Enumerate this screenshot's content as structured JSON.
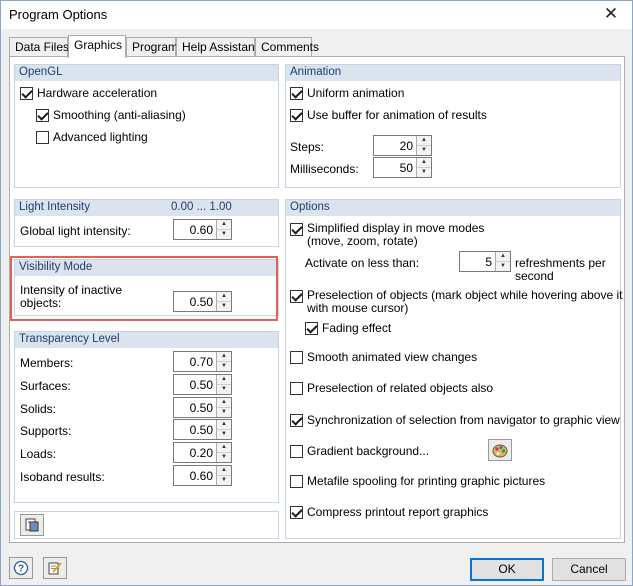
{
  "window": {
    "title": "Program Options"
  },
  "tabs": [
    "Data Files",
    "Graphics",
    "Program",
    "Help Assistant",
    "Comments"
  ],
  "opengl": {
    "header": "OpenGL",
    "hardware_acceleration": "Hardware acceleration",
    "smoothing": "Smoothing (anti-aliasing)",
    "advanced_lighting": "Advanced lighting"
  },
  "animation": {
    "header": "Animation",
    "uniform": "Uniform animation",
    "buffer": "Use buffer for animation of results",
    "steps_label": "Steps:",
    "steps_value": "20",
    "ms_label": "Milliseconds:",
    "ms_value": "50"
  },
  "light": {
    "header": "Light Intensity",
    "range": "0.00 ... 1.00",
    "global_label": "Global light intensity:",
    "global_value": "0.60"
  },
  "visibility": {
    "header": "Visibility Mode",
    "inactive_label_1": "Intensity of inactive",
    "inactive_label_2": "objects:",
    "inactive_value": "0.50"
  },
  "transparency": {
    "header": "Transparency Level",
    "rows": [
      {
        "label": "Members:",
        "value": "0.70"
      },
      {
        "label": "Surfaces:",
        "value": "0.50"
      },
      {
        "label": "Solids:",
        "value": "0.50"
      },
      {
        "label": "Supports:",
        "value": "0.50"
      },
      {
        "label": "Loads:",
        "value": "0.20"
      },
      {
        "label": "Isoband results:",
        "value": "0.60"
      }
    ]
  },
  "options": {
    "header": "Options",
    "simplified_1": "Simplified display in move modes",
    "simplified_2": "(move, zoom, rotate)",
    "activate_label": "Activate on less than:",
    "activate_value": "5",
    "refresh_1": "refreshments per",
    "refresh_2": "second",
    "preselection_1": "Preselection of objects (mark object while hovering above it",
    "preselection_2": "with mouse cursor)",
    "fading": "Fading effect",
    "smooth_view": "Smooth animated view changes",
    "preselection_related": "Preselection of related objects also",
    "synchronization": "Synchronization of selection from navigator to graphic view",
    "gradient": "Gradient background...",
    "metafile": "Metafile spooling for printing graphic pictures",
    "compress": "Compress printout report graphics"
  },
  "footer": {
    "ok": "OK",
    "cancel": "Cancel"
  },
  "colors": {
    "group_header_bg": "#dae3ee",
    "group_header_text": "#1e3f6e",
    "highlight": "#e0605a",
    "default_button": "#0078d7"
  }
}
